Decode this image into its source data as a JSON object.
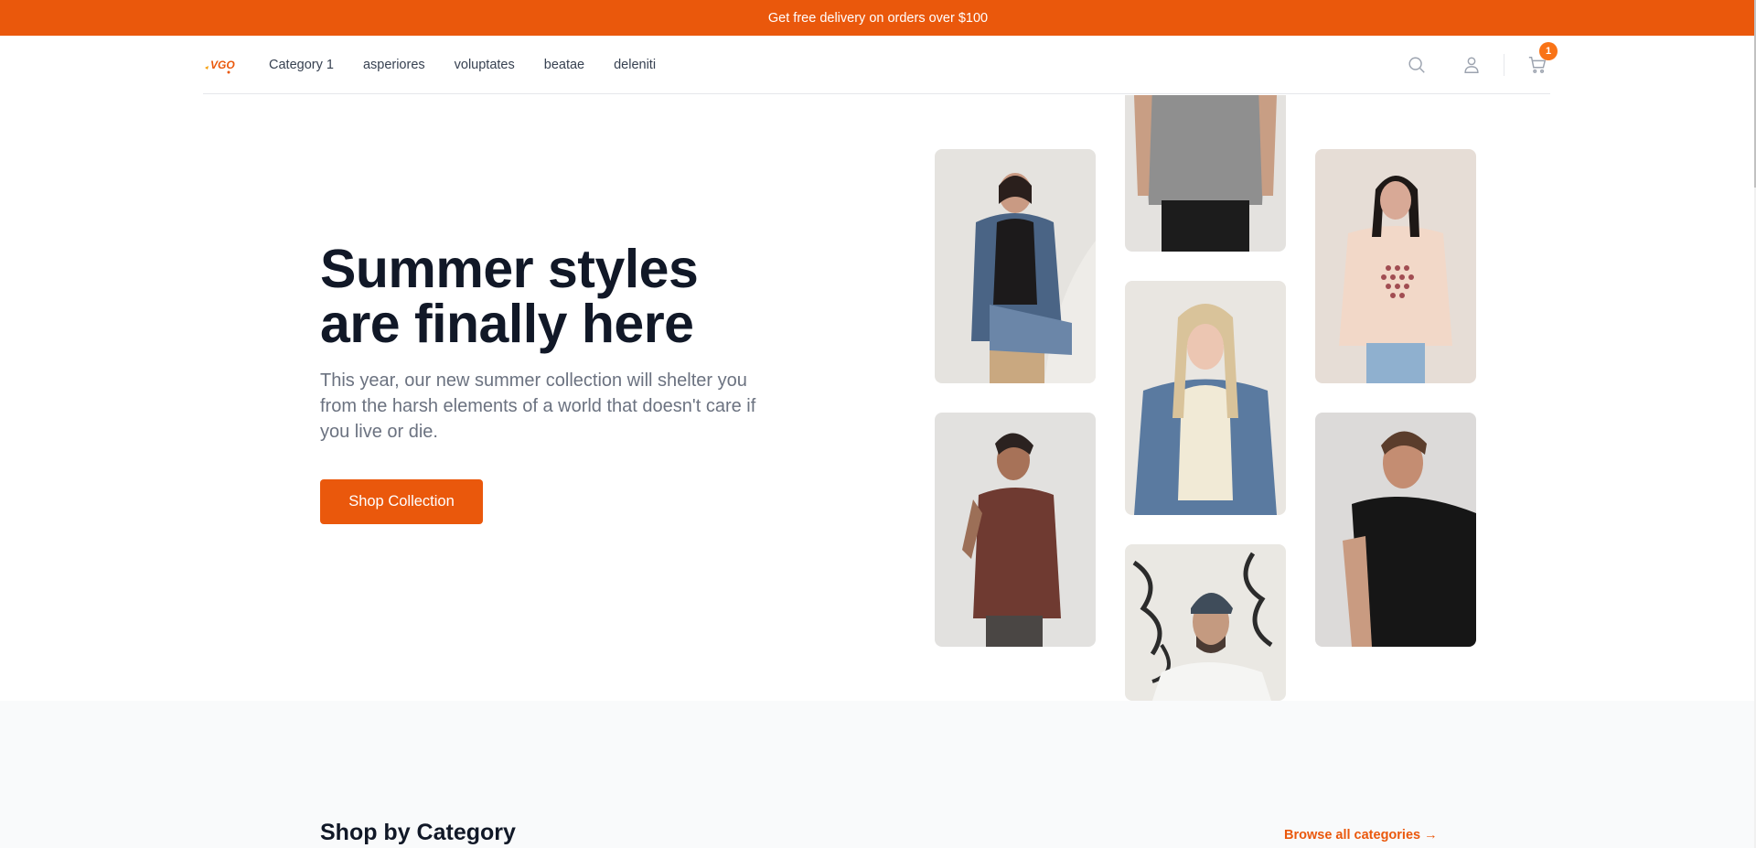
{
  "promo": {
    "text": "Get free delivery on orders over $100"
  },
  "header": {
    "logo_text": "VGO",
    "nav": [
      {
        "label": "Category 1"
      },
      {
        "label": "asperiores"
      },
      {
        "label": "voluptates"
      },
      {
        "label": "beatae"
      },
      {
        "label": "deleniti"
      }
    ],
    "cart_count": "1",
    "icons": [
      "search-icon",
      "user-icon",
      "cart-icon"
    ]
  },
  "hero": {
    "title_line1": "Summer styles",
    "title_line2": "are finally here",
    "description": "This year, our new summer collection will shelter you from the harsh elements of a world that doesn't care if you live or die.",
    "cta_label": "Shop Collection"
  },
  "categories": {
    "title": "Shop by Category",
    "browse_label": "Browse all categories →"
  },
  "colors": {
    "accent": "#ea580c",
    "badge": "#f97316",
    "heading": "#111827",
    "body_text": "#6b7280"
  }
}
